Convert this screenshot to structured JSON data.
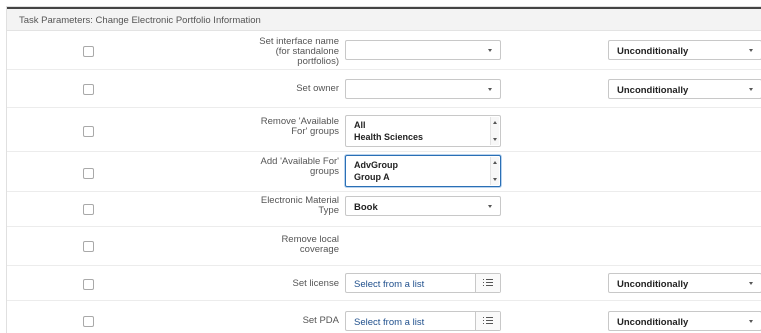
{
  "header": {
    "title": "Task Parameters: Change Electronic Portfolio Information"
  },
  "rows": {
    "interface_name": {
      "label": "Set interface name (for standalone portfolios)",
      "value": "",
      "condition": "Unconditionally"
    },
    "owner": {
      "label": "Set owner",
      "value": "",
      "condition": "Unconditionally"
    },
    "remove_available_for": {
      "label": "Remove 'Available For' groups",
      "options": [
        "All",
        "Health Sciences"
      ]
    },
    "add_available_for": {
      "label": "Add 'Available For' groups",
      "options": [
        "AdvGroup",
        "Group A"
      ]
    },
    "material_type": {
      "label": "Electronic Material Type",
      "value": "Book"
    },
    "remove_local_coverage": {
      "label": "Remove local coverage"
    },
    "license": {
      "label": "Set license",
      "placeholder": "Select from a list",
      "condition": "Unconditionally"
    },
    "pda": {
      "label": "Set PDA",
      "placeholder": "Select from a list",
      "condition": "Unconditionally"
    }
  },
  "icons": {
    "dropdown": "chevron-down-icon",
    "scroll_up": "chevron-up-icon",
    "list": "list-icon"
  },
  "colors": {
    "focus_border": "#2a6fb5",
    "link_text": "#1f4f8c",
    "header_bg": "#f3f3f3"
  }
}
